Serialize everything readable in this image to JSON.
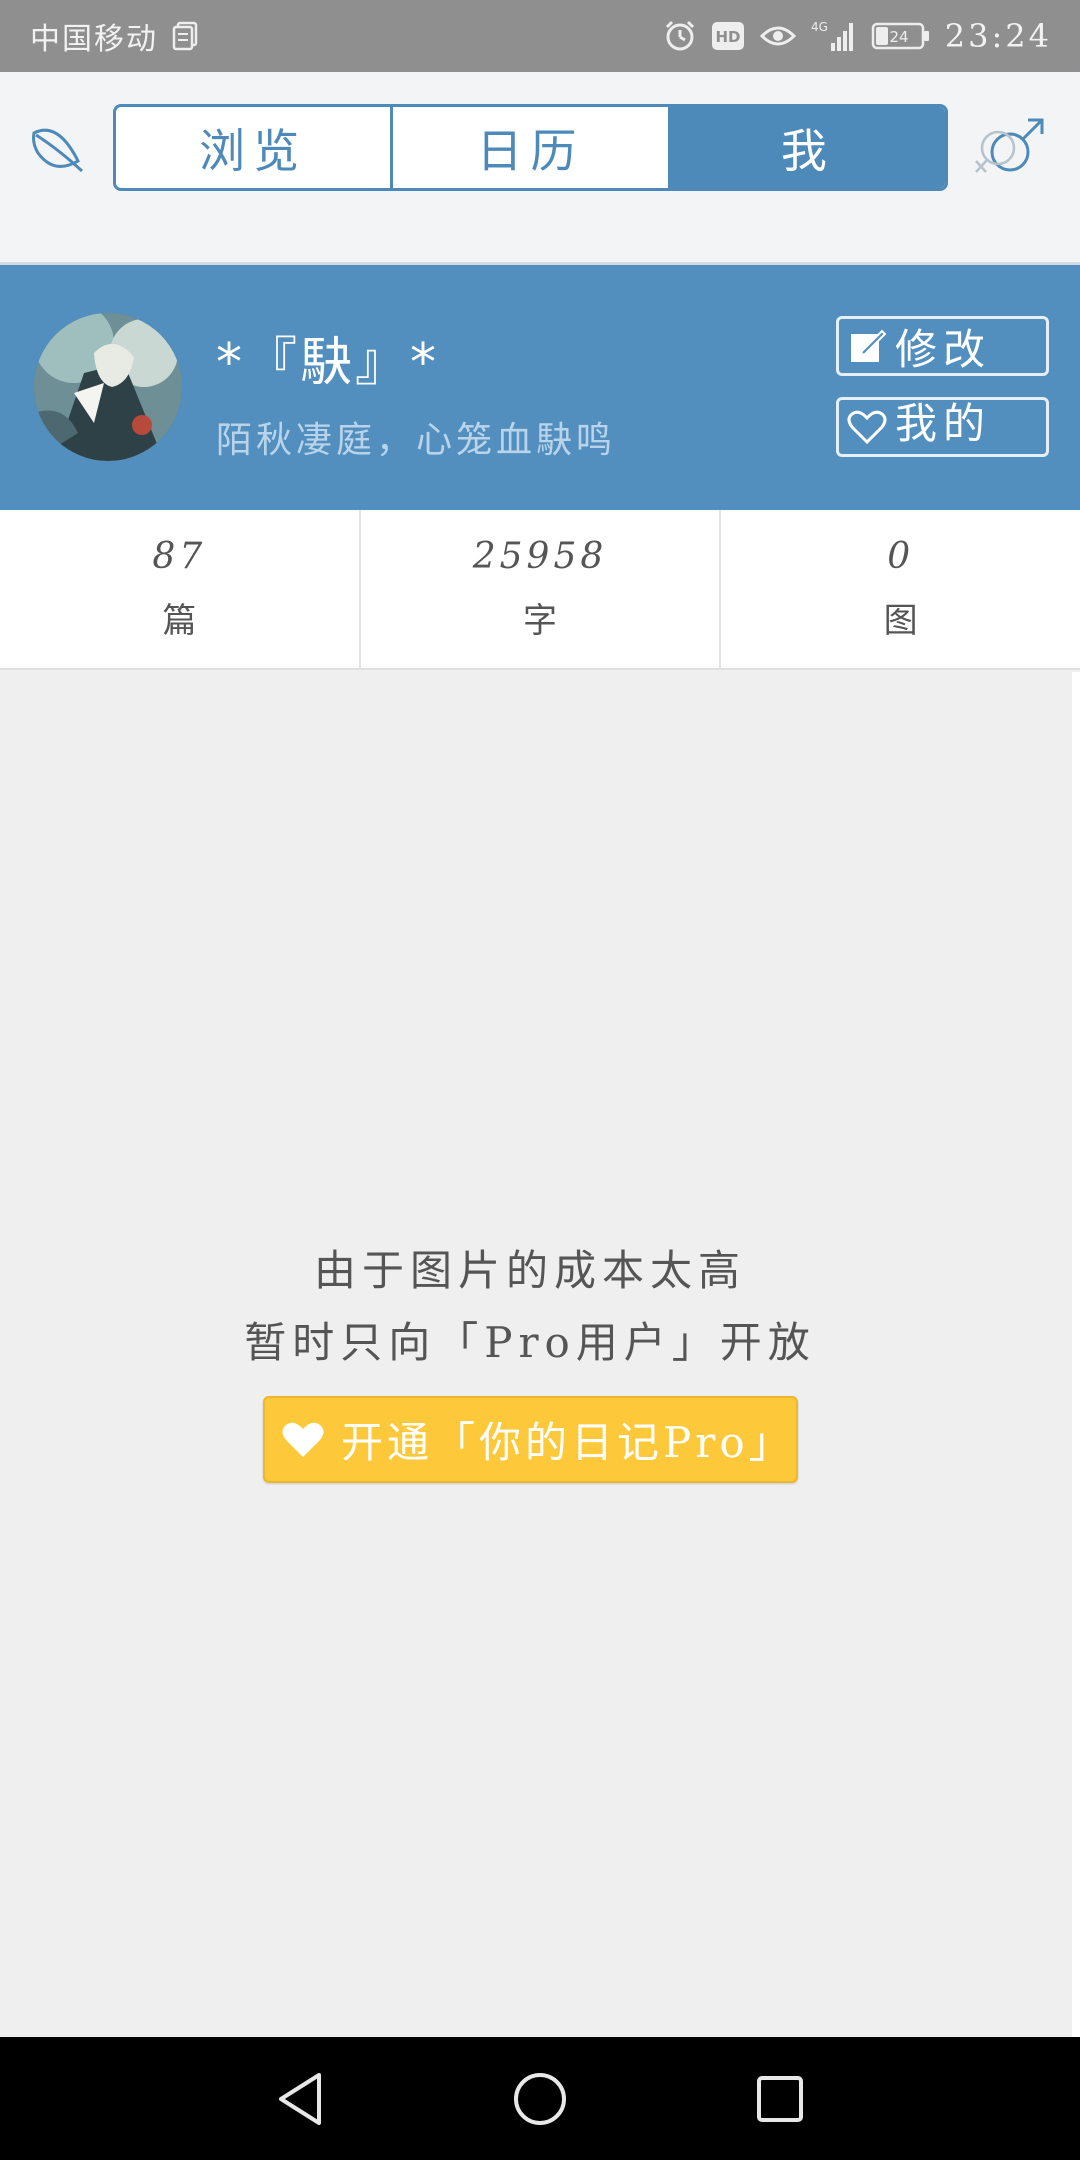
{
  "status_bar": {
    "carrier": "中国移动",
    "network": "4G",
    "battery": "24",
    "time": "23:24"
  },
  "nav": {
    "tabs": [
      {
        "label": "浏览",
        "active": false
      },
      {
        "label": "日历",
        "active": false
      },
      {
        "label": "我",
        "active": true
      }
    ]
  },
  "profile": {
    "name": "*『駃』*",
    "signature": "陌秋凄庭，心笼血駃鸣",
    "edit_label": "修改",
    "mine_label": "我的"
  },
  "stats": [
    {
      "value": "87",
      "label": "篇"
    },
    {
      "value": "25958",
      "label": "字"
    },
    {
      "value": "0",
      "label": "图"
    }
  ],
  "empty_state": {
    "line1": "由于图片的成本太高",
    "line2": "暂时只向「Pro用户」开放",
    "pro_button": "开通「你的日记Pro」"
  },
  "colors": {
    "primary": "#528fbe",
    "accent": "#fdc93a",
    "status_bar": "#8f8f8f"
  }
}
